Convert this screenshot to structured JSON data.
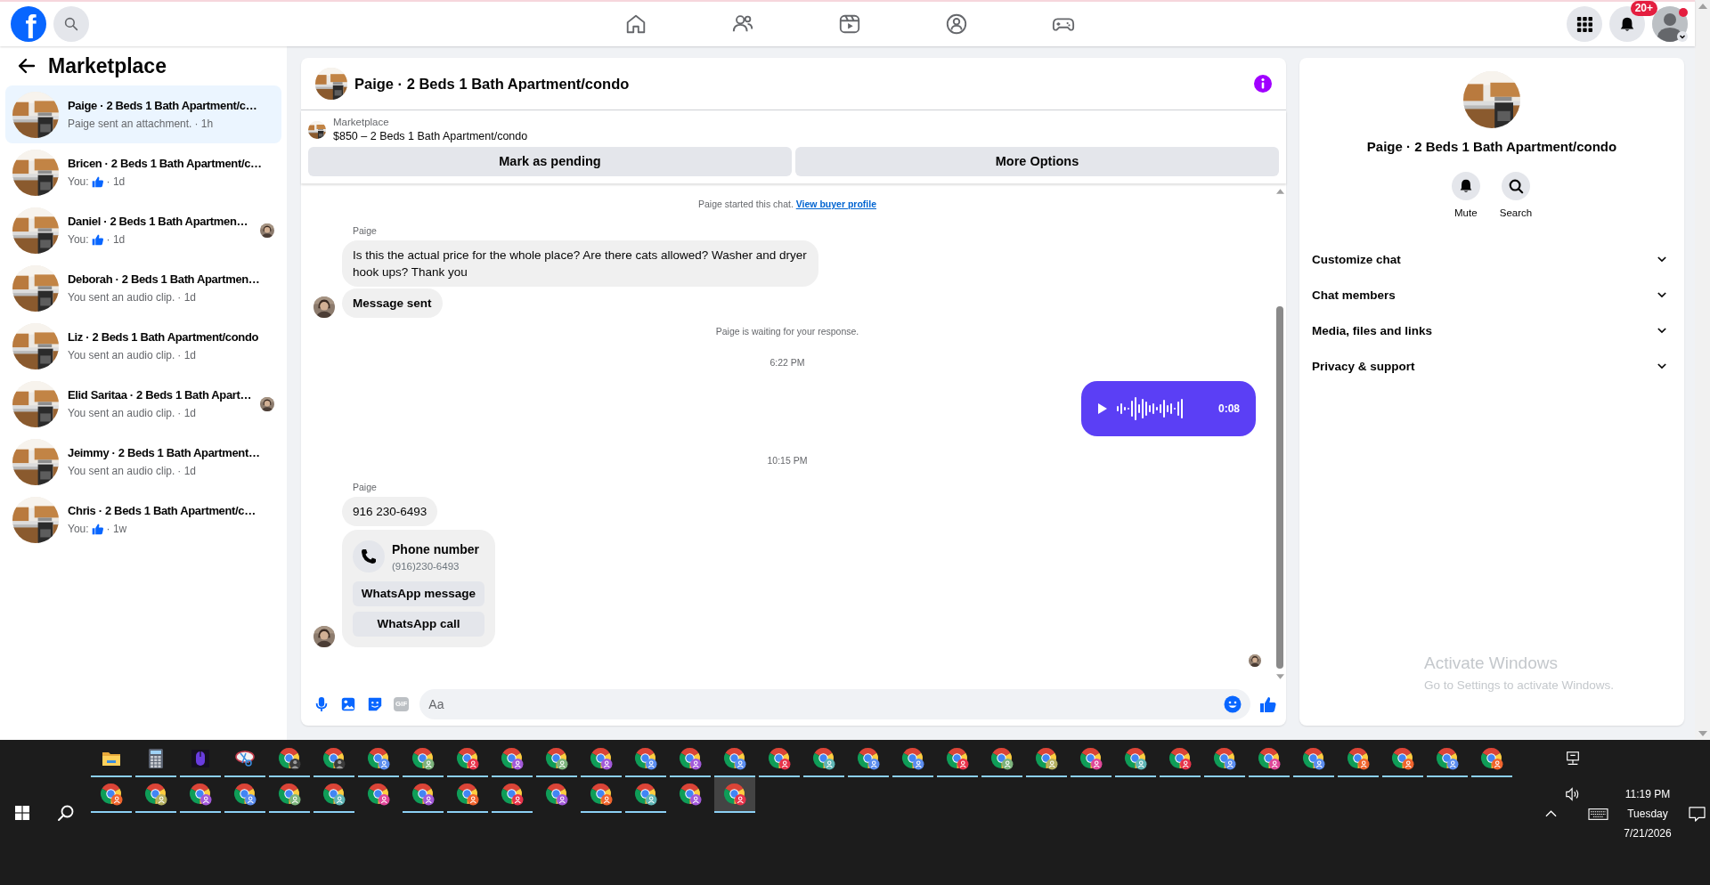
{
  "top_bar": {
    "logo": "f",
    "notification_badge": "20+"
  },
  "sidebar": {
    "title": "Marketplace",
    "conversations": [
      {
        "name": "Paige · 2 Beds 1 Bath Apartment/c…",
        "kind": "text",
        "preview": "Paige sent an attachment.",
        "meta": "· 1h",
        "selected": true,
        "seen": false
      },
      {
        "name": "Bricen · 2 Beds 1 Bath Apartment/c…",
        "kind": "like",
        "preview": "You:",
        "meta": "· 1d",
        "selected": false,
        "seen": false
      },
      {
        "name": "Daniel · 2 Beds 1 Bath Apartmen…",
        "kind": "like",
        "preview": "You:",
        "meta": "· 1d",
        "selected": false,
        "seen": true
      },
      {
        "name": "Deborah · 2 Beds 1 Bath Apartmen…",
        "kind": "text",
        "preview": "You sent an audio clip.",
        "meta": "· 1d",
        "selected": false,
        "seen": false
      },
      {
        "name": "Liz · 2 Beds 1 Bath Apartment/condo",
        "kind": "text",
        "preview": "You sent an audio clip.",
        "meta": "· 1d",
        "selected": false,
        "seen": false
      },
      {
        "name": "Elid Saritaa · 2 Beds 1 Bath Apart…",
        "kind": "text",
        "preview": "You sent an audio clip.",
        "meta": "· 1d",
        "selected": false,
        "seen": true
      },
      {
        "name": "Jeimmy · 2 Beds 1 Bath Apartment…",
        "kind": "text",
        "preview": "You sent an audio clip.",
        "meta": "· 1d",
        "selected": false,
        "seen": false
      },
      {
        "name": "Chris · 2 Beds 1 Bath Apartment/c…",
        "kind": "like",
        "preview": "You:",
        "meta": "· 1w",
        "selected": false,
        "seen": false
      }
    ]
  },
  "chat": {
    "title": "Paige · 2 Beds 1 Bath Apartment/condo",
    "listing": {
      "label": "Marketplace",
      "text": "$850 – 2 Beds 1 Bath Apartment/condo"
    },
    "actions": [
      "Mark as pending",
      "More Options"
    ],
    "messages": [
      {
        "kind": "system",
        "text": "Paige started this chat.",
        "link": "View buyer profile"
      },
      {
        "kind": "sender",
        "text": "Paige"
      },
      {
        "kind": "incoming",
        "text": "Is this the actual price for the whole place? Are there cats allowed? Washer and dryer hook ups? Thank you",
        "avatar": false
      },
      {
        "kind": "notice",
        "text": "Message sent",
        "avatar": true
      },
      {
        "kind": "system",
        "text": "Paige is waiting for your response."
      },
      {
        "kind": "time",
        "text": "6:22 PM"
      },
      {
        "kind": "audio",
        "duration": "0:08"
      },
      {
        "kind": "time",
        "text": "10:15 PM"
      },
      {
        "kind": "sender",
        "text": "Paige"
      },
      {
        "kind": "incoming",
        "text": "916 230-6493",
        "avatar": false
      },
      {
        "kind": "contact",
        "title": "Phone number",
        "detail": "(916)230-6493",
        "buttons": [
          "WhatsApp message",
          "WhatsApp call"
        ],
        "avatar": true
      }
    ],
    "composer": {
      "gif_label": "GIF",
      "placeholder": "Aa"
    }
  },
  "details": {
    "title": "Paige · 2 Beds 1 Bath Apartment/condo",
    "actions": [
      "Mute",
      "Search"
    ],
    "sections": [
      {
        "label": "Customize chat",
        "expanded": false
      },
      {
        "label": "Chat members",
        "expanded": false
      },
      {
        "label": "Media, files and links",
        "expanded": false
      },
      {
        "label": "Privacy & support",
        "expanded": false
      }
    ]
  },
  "activation_notice": {
    "title": "Activate Windows",
    "text": "Go to Settings to activate Windows."
  },
  "taskbar": {
    "apps": [
      {
        "kind": "explorer",
        "running": true,
        "selected": false
      },
      {
        "kind": "calculator",
        "running": true,
        "selected": false
      },
      {
        "kind": "app",
        "running": true,
        "selected": false
      },
      {
        "kind": "snipping",
        "running": true,
        "selected": false
      },
      {
        "kind": "chrome-photo",
        "running": true,
        "selected": false
      },
      {
        "kind": "chrome-photo",
        "running": true,
        "selected": false
      },
      {
        "kind": "chrome",
        "color": "#5b8def",
        "running": true,
        "selected": false
      },
      {
        "kind": "chrome",
        "color": "#7cb37c",
        "running": true,
        "selected": false
      },
      {
        "kind": "chrome",
        "color": "#e8334a",
        "running": true,
        "selected": false
      },
      {
        "kind": "chrome",
        "color": "#a259d9",
        "running": true,
        "selected": false
      },
      {
        "kind": "chrome",
        "color": "#7cb37c",
        "running": true,
        "selected": false
      },
      {
        "kind": "chrome",
        "color": "#a259d9",
        "running": true,
        "selected": false
      },
      {
        "kind": "chrome",
        "color": "#5b8def",
        "running": true,
        "selected": false
      },
      {
        "kind": "chrome",
        "color": "#a259d9",
        "running": true,
        "selected": false
      },
      {
        "kind": "chrome",
        "color": "#5b8def",
        "running": true,
        "selected": false
      },
      {
        "kind": "chrome",
        "color": "#e8334a",
        "running": true,
        "selected": false
      },
      {
        "kind": "chrome",
        "color": "#5fb5b5",
        "running": true,
        "selected": false
      },
      {
        "kind": "chrome",
        "color": "#5b8def",
        "running": true,
        "selected": false
      },
      {
        "kind": "chrome",
        "color": "#5b8def",
        "running": true,
        "selected": false
      },
      {
        "kind": "chrome",
        "color": "#e8334a",
        "running": true,
        "selected": false
      },
      {
        "kind": "chrome",
        "color": "#7cb37c",
        "running": true,
        "selected": false
      },
      {
        "kind": "chrome",
        "color": "#b5b060",
        "running": true,
        "selected": false
      },
      {
        "kind": "chrome",
        "color": "#e0489a",
        "running": true,
        "selected": false
      },
      {
        "kind": "chrome",
        "color": "#5fb5b5",
        "running": true,
        "selected": false
      },
      {
        "kind": "chrome",
        "color": "#e8334a",
        "running": true,
        "selected": false
      },
      {
        "kind": "chrome",
        "color": "#5b8def",
        "running": true,
        "selected": false
      },
      {
        "kind": "chrome",
        "color": "#e0489a",
        "running": true,
        "selected": false
      },
      {
        "kind": "chrome",
        "color": "#5b8def",
        "running": true,
        "selected": false
      },
      {
        "kind": "chrome",
        "color": "#f0642d",
        "running": true,
        "selected": false
      },
      {
        "kind": "chrome",
        "color": "#f0642d",
        "running": true,
        "selected": false
      },
      {
        "kind": "chrome",
        "color": "#5b8def",
        "running": true,
        "selected": false
      },
      {
        "kind": "chrome",
        "color": "#f0642d",
        "running": true,
        "selected": false
      },
      {
        "kind": "chrome",
        "color": "#f0642d",
        "running": true,
        "selected": false
      },
      {
        "kind": "chrome",
        "color": "#b5b060",
        "running": true,
        "selected": false
      },
      {
        "kind": "chrome",
        "color": "#a259d9",
        "running": true,
        "selected": false
      },
      {
        "kind": "chrome",
        "color": "#5b8def",
        "running": true,
        "selected": false
      },
      {
        "kind": "chrome",
        "color": "#7cb37c",
        "running": true,
        "selected": false
      },
      {
        "kind": "chrome",
        "color": "#5fb5b5",
        "running": true,
        "selected": false
      },
      {
        "kind": "chrome",
        "color": "#e0489a",
        "running": false,
        "selected": false
      },
      {
        "kind": "chrome",
        "color": "#a259d9",
        "running": true,
        "selected": false
      },
      {
        "kind": "chrome",
        "color": "#f0642d",
        "running": true,
        "selected": false
      },
      {
        "kind": "chrome",
        "color": "#e8334a",
        "running": true,
        "selected": false
      },
      {
        "kind": "chrome",
        "color": "#a259d9",
        "running": false,
        "selected": false
      },
      {
        "kind": "chrome",
        "color": "#f0642d",
        "running": true,
        "selected": false
      },
      {
        "kind": "chrome",
        "color": "#5fb5b5",
        "running": true,
        "selected": false
      },
      {
        "kind": "chrome",
        "color": "#a259d9",
        "running": false,
        "selected": false
      },
      {
        "kind": "chrome",
        "color": "#e8334a",
        "running": true,
        "selected": true
      }
    ],
    "clock": {
      "time": "11:19 PM",
      "day": "Tuesday",
      "date": "7/21/2026"
    }
  }
}
